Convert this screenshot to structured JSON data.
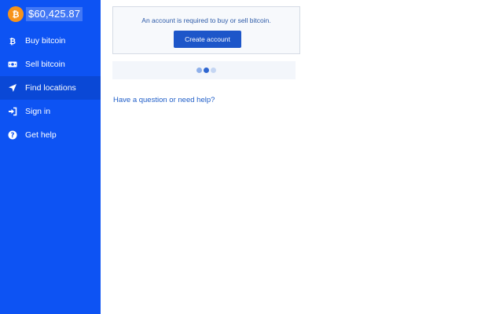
{
  "header": {
    "price": "$60,425.87",
    "logo_icon": "bitcoin-logo-icon"
  },
  "sidebar": {
    "items": [
      {
        "label": "Buy bitcoin",
        "icon": "bitcoin-symbol-icon",
        "active": false
      },
      {
        "label": "Sell bitcoin",
        "icon": "cash-icon",
        "active": false
      },
      {
        "label": "Find locations",
        "icon": "location-arrow-icon",
        "active": true
      },
      {
        "label": "Sign in",
        "icon": "sign-in-icon",
        "active": false
      },
      {
        "label": "Get help",
        "icon": "question-circle-icon",
        "active": false
      }
    ]
  },
  "main": {
    "account_message": "An account is required to buy or sell bitcoin.",
    "create_account_label": "Create account",
    "help_link": "Have a question or need help?"
  },
  "colors": {
    "sidebar": "#0d53f3",
    "sidebar_active": "#0a48d6",
    "bitcoin_orange": "#f7931a",
    "button": "#1d56c9",
    "link": "#1f5ec8"
  }
}
